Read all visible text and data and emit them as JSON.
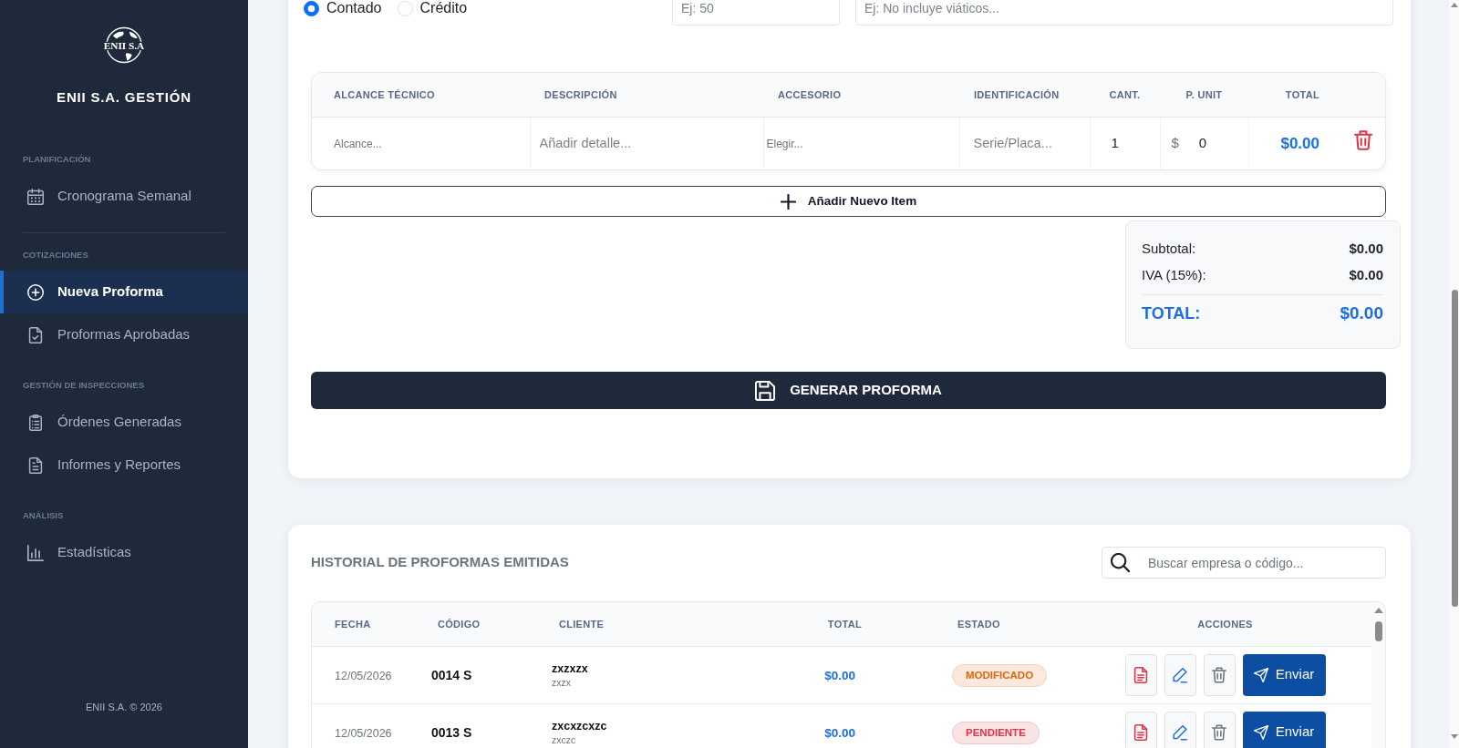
{
  "sidebar": {
    "logo_text": "ENII S.A",
    "title": "ENII S.A. GESTIÓN",
    "sections": [
      {
        "label": "PLANIFICACIÓN",
        "divider_after": true,
        "items": [
          {
            "label": "Cronograma Semanal",
            "selected": false
          }
        ]
      },
      {
        "label": "COTIZACIONES",
        "divider_after": false,
        "items": [
          {
            "label": "Nueva Proforma",
            "selected": true
          },
          {
            "label": "Proformas Aprobadas",
            "selected": false
          }
        ]
      },
      {
        "label": "GESTIÓN DE INSPECCIONES",
        "divider_after": false,
        "items": [
          {
            "label": "Órdenes Generadas",
            "selected": false
          },
          {
            "label": "Informes y Reportes",
            "selected": false
          }
        ]
      },
      {
        "label": "ANÁLISIS",
        "divider_after": false,
        "items": [
          {
            "label": "Estadísticas",
            "selected": false
          }
        ]
      }
    ],
    "footer": "ENII S.A. © 2026"
  },
  "proforma_form": {
    "payment_options": [
      {
        "label": "Contado",
        "selected": true
      },
      {
        "label": "Crédito",
        "selected": false
      }
    ],
    "fields": [
      {
        "placeholder": "Ej: 50"
      },
      {
        "placeholder": "Ej: No incluye viáticos..."
      }
    ],
    "items_table": {
      "columns": [
        "ALCANCE TÉCNICO",
        "DESCRIPCIÓN",
        "ACCESORIO",
        "IDENTIFICACIÓN",
        "CANT.",
        "P. UNIT",
        "TOTAL"
      ],
      "rows": [
        {
          "scope": {
            "placeholder": "Alcance..."
          },
          "description": {
            "placeholder": "Añadir detalle..."
          },
          "accessory": {
            "placeholder": "Elegir..."
          },
          "identification": {
            "placeholder": "Serie/Placa..."
          },
          "quantity": {
            "value": "1"
          },
          "currency": "$",
          "unit_price": {
            "value": "0"
          },
          "total": "$0.00"
        }
      ]
    },
    "add_item_button": "Añadir Nuevo Item",
    "totals": {
      "lines": [
        {
          "label": "Subtotal:",
          "value": "$0.00"
        },
        {
          "label": "IVA (15%):",
          "value": "$0.00"
        }
      ],
      "grand_total": {
        "label": "TOTAL:",
        "value": "$0.00"
      }
    },
    "generate_button": "GENERAR PROFORMA"
  },
  "history": {
    "title": "HISTORIAL DE PROFORMAS EMITIDAS",
    "search": {
      "placeholder": "Buscar empresa o código..."
    },
    "columns": [
      "FECHA",
      "CÓDIGO",
      "CLIENTE",
      "TOTAL",
      "ESTADO",
      "ACCIONES"
    ],
    "rows": [
      {
        "date": "12/05/2026",
        "code": "0014 S",
        "client": "zxzxzx",
        "client_detail": "zxzx",
        "total": "$0.00",
        "status": {
          "label": "MODIFICADO",
          "color": "#e0650d"
        },
        "send_button": "Enviar"
      },
      {
        "date": "12/05/2026",
        "code": "0013 S",
        "client": "zxcxzcxzc",
        "client_detail": "zxczc",
        "total": "$0.00",
        "status": {
          "label": "PENDIENTE",
          "color": "#dc3545"
        },
        "send_button": "Enviar"
      }
    ]
  }
}
